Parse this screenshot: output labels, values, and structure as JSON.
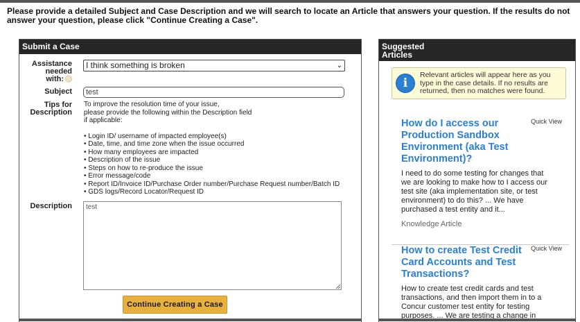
{
  "intro": "Please provide a detailed Subject and Case Description and we will search to locate an Article that answers your question. If the results do not answer your question, please click \"Continue Creating a Case\".",
  "submit_panel": {
    "title": "Submit a Case",
    "assistance_label_1": "Assistance",
    "assistance_label_2": "needed",
    "assistance_label_3": "with:",
    "assistance_value": "I think something is broken",
    "subject_label": "Subject",
    "subject_value": "test",
    "tips_label_1": "Tips for",
    "tips_label_2": "Description",
    "tips_intro_1": "To improve the resolution time of your issue,",
    "tips_intro_2": "please provide the following within the Description field",
    "tips_intro_3": "if applicable:",
    "tips_items": [
      "• Login ID/ username of impacted employee(s)",
      "• Date, time, and time zone when the issue occurred",
      "• How many employees are impacted",
      "• Description of the issue",
      "• Steps on how to re-produce the issue",
      "• Error message/code",
      "• Report ID/Invoice ID/Purchase Order number/Purchase Request number/Batch ID",
      "• GDS logs/Record Locator/Request ID"
    ],
    "description_label": "Description",
    "description_value": "test",
    "continue_label": "Continue Creating a Case"
  },
  "suggested": {
    "title_1": "Suggested",
    "title_2": "Articles",
    "info_text": "Relevant articles will appear here as you type in the case details. If no results are returned, then no matches were found.",
    "info_icon": "info-icon",
    "articles": [
      {
        "title": "How do I access our Production Sandbox Environment (aka Test Environment)?",
        "quick_view": "Quick View",
        "snippet": "I need to do some testing for changes that we are looking to make how to I access our test site (aka implementation site, or test environment) to do this? ... We have purchased a test entity and it...",
        "type": "Knowledge Article"
      },
      {
        "title": "How to create Test Credit Card Accounts and Test Transactions?",
        "quick_view": "Quick View",
        "snippet": "How to create test credit cards and test transactions, and then import them in to a Concur customer test entity for testing purposes. ... We are testing a change in"
      }
    ]
  },
  "colors": {
    "header_bg": "#262626",
    "link_blue": "#2a7fd4",
    "button_orange": "#e8b13e",
    "info_bg": "#fdfbd8"
  }
}
